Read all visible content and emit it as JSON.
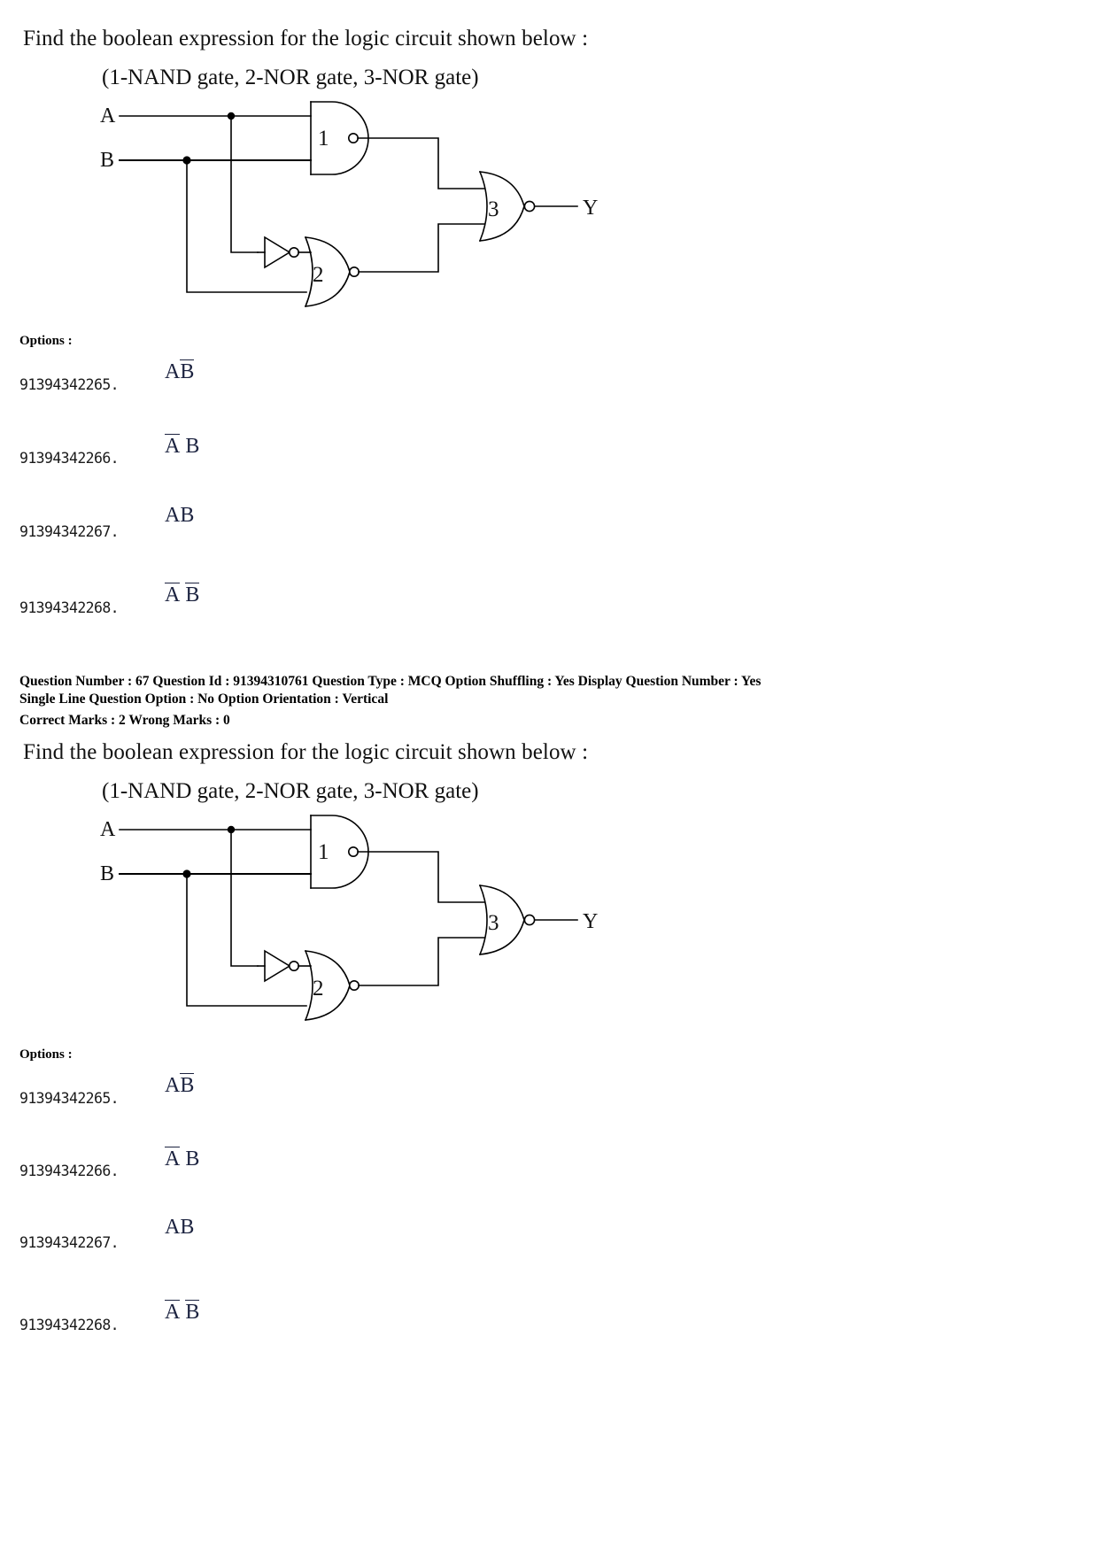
{
  "document": {
    "type": "exam-question-paper",
    "background": "#ffffff",
    "text_color": "#000000",
    "accent_color": "#1c2340"
  },
  "question_blocks": [
    {
      "prompt": "Find the boolean expression for the logic circuit shown below :",
      "subtitle": "(1-NAND gate, 2-NOR gate, 3-NOR gate)",
      "circuit": {
        "inputs": [
          "A",
          "B"
        ],
        "output": "Y",
        "gates": [
          {
            "number": "1",
            "type": "NAND"
          },
          {
            "number": "2",
            "type": "NOR"
          },
          {
            "number": "3",
            "type": "NOR"
          }
        ],
        "has_inverter": true
      },
      "options_label": "Options :",
      "options": [
        {
          "id": "91394342265.",
          "expr_parts": [
            {
              "text": "A",
              "bar": false
            },
            {
              "text": "B",
              "bar": true
            }
          ],
          "gap": false
        },
        {
          "id": "91394342266.",
          "expr_parts": [
            {
              "text": "A",
              "bar": true
            },
            {
              "text": "B",
              "bar": false
            }
          ],
          "gap": true
        },
        {
          "id": "91394342267.",
          "expr_parts": [
            {
              "text": "A",
              "bar": false
            },
            {
              "text": "B",
              "bar": false
            }
          ],
          "gap": false
        },
        {
          "id": "91394342268.",
          "expr_parts": [
            {
              "text": "A",
              "bar": true
            },
            {
              "text": "B",
              "bar": true
            }
          ],
          "gap": true
        }
      ]
    },
    {
      "prompt": "Find the boolean expression for the logic circuit shown below :",
      "subtitle": "(1-NAND gate, 2-NOR gate, 3-NOR gate)",
      "circuit": {
        "inputs": [
          "A",
          "B"
        ],
        "output": "Y",
        "gates": [
          {
            "number": "1",
            "type": "NAND"
          },
          {
            "number": "2",
            "type": "NOR"
          },
          {
            "number": "3",
            "type": "NOR"
          }
        ],
        "has_inverter": true
      },
      "options_label": "Options :",
      "options": [
        {
          "id": "91394342265.",
          "expr_parts": [
            {
              "text": "A",
              "bar": false
            },
            {
              "text": "B",
              "bar": true
            }
          ],
          "gap": false
        },
        {
          "id": "91394342266.",
          "expr_parts": [
            {
              "text": "A",
              "bar": true
            },
            {
              "text": "B",
              "bar": false
            }
          ],
          "gap": true
        },
        {
          "id": "91394342267.",
          "expr_parts": [
            {
              "text": "A",
              "bar": false
            },
            {
              "text": "B",
              "bar": false
            }
          ],
          "gap": false
        },
        {
          "id": "91394342268.",
          "expr_parts": [
            {
              "text": "A",
              "bar": true
            },
            {
              "text": "B",
              "bar": true
            }
          ],
          "gap": true
        }
      ]
    }
  ],
  "metadata": {
    "line1": "Question Number : 67  Question Id : 91394310761  Question Type : MCQ  Option Shuffling : Yes  Display Question Number : Yes",
    "line2": "Single Line Question Option : No  Option Orientation : Vertical",
    "line3": "Correct Marks : 2  Wrong Marks : 0",
    "fields": {
      "question_number": "67",
      "question_id": "91394310761",
      "question_type": "MCQ",
      "option_shuffling": "Yes",
      "display_question_number": "Yes",
      "single_line_question_option": "No",
      "option_orientation": "Vertical",
      "correct_marks": "2",
      "wrong_marks": "0"
    }
  }
}
